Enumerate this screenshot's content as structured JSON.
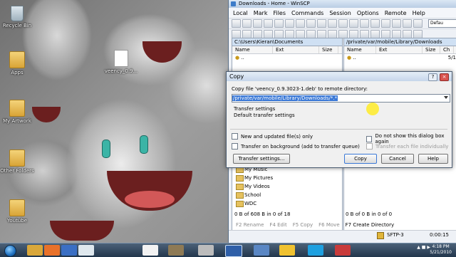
{
  "desktop": {
    "icons": [
      {
        "label": "Recycle Bin",
        "kind": "bin"
      },
      {
        "label": "Apps",
        "kind": "folder"
      },
      {
        "label": "My Artwork",
        "kind": "folder"
      },
      {
        "label": "Other Folders",
        "kind": "folder"
      },
      {
        "label": "Youtube",
        "kind": "folder"
      },
      {
        "label": "veency_0.9...",
        "kind": "file"
      }
    ]
  },
  "window": {
    "title": "Downloads - Home - WinSCP",
    "menu": [
      "Local",
      "Mark",
      "Files",
      "Commands",
      "Session",
      "Options",
      "Remote",
      "Help"
    ],
    "toolbar": {
      "transfer_settings": "Defau"
    },
    "left_panel": {
      "path": "C:\\Users\\Kieran\\Documents",
      "columns": [
        "Name",
        "Ext",
        "Size"
      ],
      "rows": [
        ".."
      ],
      "tree": [
        "My Music",
        "My Pictures",
        "My Videos",
        "School",
        "WDC"
      ],
      "status": "0 B of 608 B in 0 of 18"
    },
    "right_panel": {
      "path": "/private/var/mobile/Library/Downloads",
      "columns": [
        "Name",
        "Ext",
        "Size",
        "Ch"
      ],
      "rows": [
        ".."
      ],
      "row_size": "5/1",
      "status": "0 B of 0 B in 0 of 0"
    },
    "commands": [
      "F2 Rename",
      "F4 Edit",
      "F5 Copy",
      "F6 Move",
      "F7 Create Directory"
    ],
    "statusbar": {
      "protocol": "SFTP-3",
      "elapsed": "0:00:15"
    }
  },
  "dialog": {
    "title": "Copy",
    "prompt": "Copy file 'veency_0.9.3023-1.deb' to remote directory:",
    "target": "/private/var/mobile/Library/Downloads/*.*",
    "settings_heading": "Transfer settings",
    "settings_value": "Default transfer settings",
    "options": {
      "new_only": "New and updated file(s) only",
      "background": "Transfer on background (add to transfer queue)",
      "dont_show": "Do not show this dialog box again",
      "each_file": "Transfer each file individually"
    },
    "buttons": {
      "settings": "Transfer settings...",
      "copy": "Copy",
      "cancel": "Cancel",
      "help": "Help"
    }
  },
  "taskbar": {
    "time": "4:18 PM",
    "date": "5/21/2010",
    "apps": [
      "explorer",
      "firefox",
      "word",
      "excel",
      "vnc",
      "gimp",
      "media",
      "winscp",
      "paint",
      "aim",
      "skype",
      "app"
    ]
  }
}
